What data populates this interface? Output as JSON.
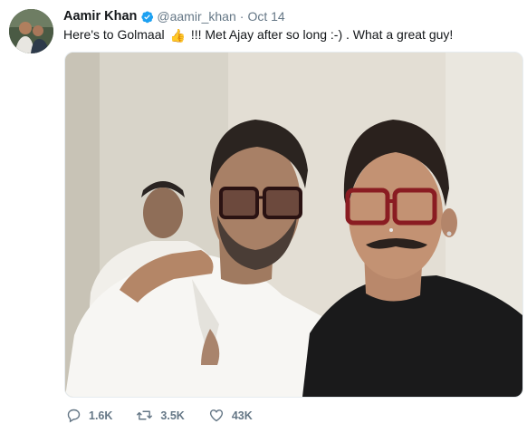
{
  "tweet": {
    "author_name": "Aamir Khan",
    "handle": "@aamir_khan",
    "separator": "·",
    "date": "Oct 14",
    "text_before_emoji": "Here's to Golmaal",
    "emoji": "👍",
    "text_after_emoji": "!!! Met Ajay after so long :-) . What a great guy!",
    "verified_icon": "verified-badge-icon",
    "media_alt": "selfie-photo"
  },
  "actions": {
    "reply_count": "1.6K",
    "retweet_count": "3.5K",
    "like_count": "43K"
  },
  "colors": {
    "text_primary": "#14171a",
    "text_secondary": "#657786",
    "verified_blue": "#1da1f2"
  }
}
